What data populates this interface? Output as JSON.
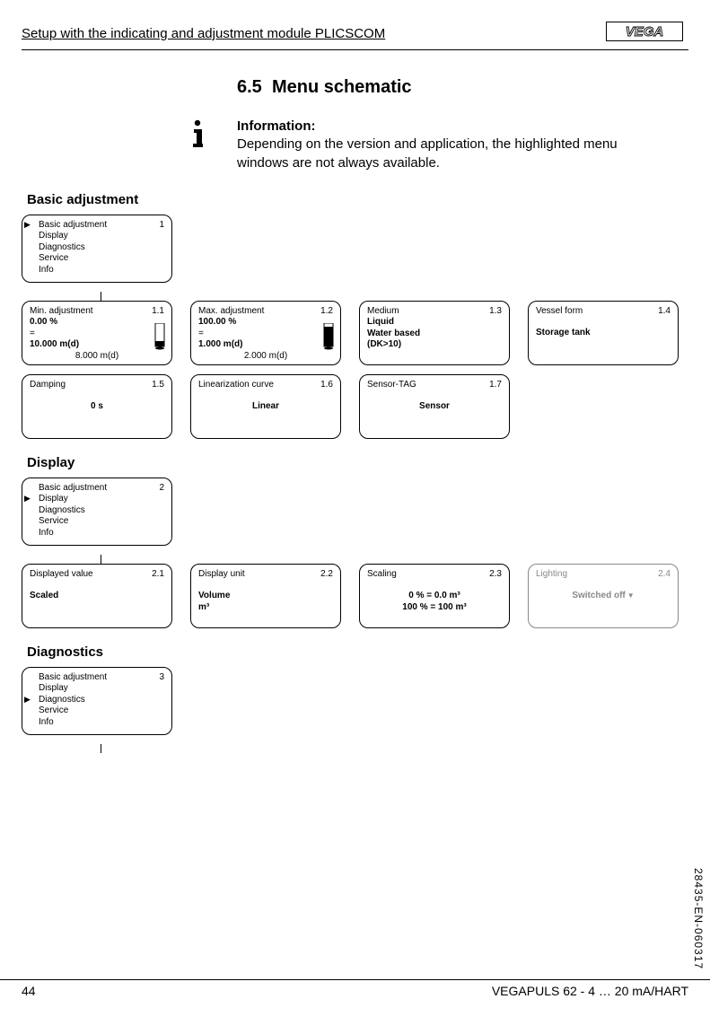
{
  "header": {
    "title": "Setup with the indicating and adjustment module PLICSCOM",
    "logo_text": "VEGA"
  },
  "section": {
    "number": "6.5",
    "title": "Menu schematic"
  },
  "info": {
    "label": "Information:",
    "text": "Depending on the version and application, the highlighted menu windows are not always available."
  },
  "basic_adjustment": {
    "heading": "Basic adjustment",
    "root": {
      "num": "1",
      "items": [
        "Basic adjustment",
        "Display",
        "Diagnostics",
        "Service",
        "Info"
      ],
      "active_index": 0
    },
    "b11": {
      "num": "1.1",
      "title": "Min. adjustment",
      "l1": "0.00 %",
      "l2": "=",
      "l3": "10.000 m(d)",
      "l4": "8.000 m(d)"
    },
    "b12": {
      "num": "1.2",
      "title": "Max. adjustment",
      "l1": "100.00 %",
      "l2": "=",
      "l3": "1.000 m(d)",
      "l4": "2.000 m(d)"
    },
    "b13": {
      "num": "1.3",
      "title": "Medium",
      "l1": "Liquid",
      "l2": "Water based",
      "l3": "(DK>10)"
    },
    "b14": {
      "num": "1.4",
      "title": "Vessel form",
      "val": "Storage tank"
    },
    "b15": {
      "num": "1.5",
      "title": "Damping",
      "val": "0 s"
    },
    "b16": {
      "num": "1.6",
      "title": "Linearization curve",
      "val": "Linear"
    },
    "b17": {
      "num": "1.7",
      "title": "Sensor-TAG",
      "val": "Sensor"
    }
  },
  "display": {
    "heading": "Display",
    "root": {
      "num": "2",
      "items": [
        "Basic adjustment",
        "Display",
        "Diagnostics",
        "Service",
        "Info"
      ],
      "active_index": 1
    },
    "b21": {
      "num": "2.1",
      "title": "Displayed value",
      "val": "Scaled"
    },
    "b22": {
      "num": "2.2",
      "title": "Display unit",
      "l1": "Volume",
      "l2": "m³"
    },
    "b23": {
      "num": "2.3",
      "title": "Scaling",
      "l1": "0 % = 0.0 m³",
      "l2": "100 % = 100 m³"
    },
    "b24": {
      "num": "2.4",
      "title": "Lighting",
      "val": "Switched off"
    }
  },
  "diagnostics": {
    "heading": "Diagnostics",
    "root": {
      "num": "3",
      "items": [
        "Basic adjustment",
        "Display",
        "Diagnostics",
        "Service",
        "Info"
      ],
      "active_index": 2
    }
  },
  "footer": {
    "page": "44",
    "doc": "VEGAPULS 62 - 4 … 20 mA/HART",
    "side_code": "28435-EN-060317"
  }
}
